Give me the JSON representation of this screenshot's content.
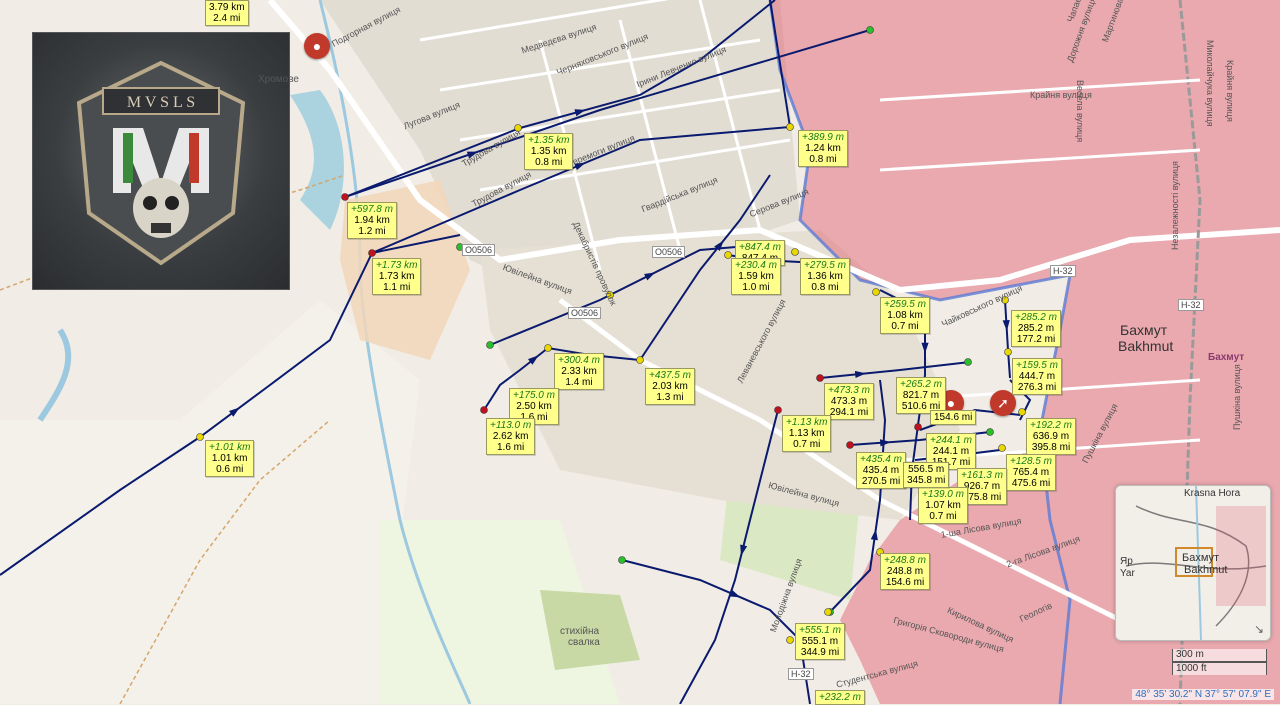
{
  "colors": {
    "occupied": "#e0576a",
    "route": "#0a1a6e",
    "label_bg": "#ffff8c",
    "start_point": "#2bbf2b",
    "end_point": "#c0121e",
    "waypoint": "#e8d800"
  },
  "logo": {
    "icon": "skull-shield-emblem",
    "text": "MVSLS"
  },
  "markers": [
    {
      "icon": "artillery-shell-icon"
    },
    {
      "icon": "artillery-shell-icon"
    },
    {
      "icon": "rifle-icon"
    }
  ],
  "distance_labels": [
    {
      "inc": "",
      "total": "3.79 km",
      "mi": "2.4 mi"
    },
    {
      "inc": "+597.8 m",
      "total": "1.94 km",
      "mi": "1.2 mi"
    },
    {
      "inc": "+1.35 km",
      "total": "1.35 km",
      "mi": "0.8 mi"
    },
    {
      "inc": "+389.9 m",
      "total": "1.24 km",
      "mi": "0.8 mi"
    },
    {
      "inc": "+1.73 km",
      "total": "1.73 km",
      "mi": "1.1 mi"
    },
    {
      "inc": "+847.4 m",
      "total": "847.4 m",
      "mi": ""
    },
    {
      "inc": "+230.4 m",
      "total": "1.59 km",
      "mi": "1.0 mi"
    },
    {
      "inc": "+279.5 m",
      "total": "1.36 km",
      "mi": "0.8 mi"
    },
    {
      "inc": "+259.5 m",
      "total": "1.08 km",
      "mi": "0.7 mi"
    },
    {
      "inc": "+285.2 m",
      "total": "285.2 m",
      "mi": "177.2 mi"
    },
    {
      "inc": "+300.4 m",
      "total": "2.33 km",
      "mi": "1.4 mi"
    },
    {
      "inc": "+437.5 m",
      "total": "2.03 km",
      "mi": "1.3 mi"
    },
    {
      "inc": "+159.5 m",
      "total": "444.7 m",
      "mi": "276.3 mi"
    },
    {
      "inc": "+175.0 m",
      "total": "2.50 km",
      "mi": "1.6 mi"
    },
    {
      "inc": "+473.3 m",
      "total": "473.3 m",
      "mi": "294.1 mi"
    },
    {
      "inc": "+265.2 m",
      "total": "821.7 m",
      "mi": "510.6 mi"
    },
    {
      "inc": "+113.0 m",
      "total": "2.62 km",
      "mi": "1.6 mi"
    },
    {
      "inc": "+1.13 km",
      "total": "1.13 km",
      "mi": "0.7 mi"
    },
    {
      "inc": "+192.2 m",
      "total": "636.9 m",
      "mi": "395.8 mi"
    },
    {
      "inc": "+244.1 m",
      "total": "244.1 m",
      "mi": "151.7 mi"
    },
    {
      "inc": "+1.01 km",
      "total": "1.01 km",
      "mi": "0.6 mi"
    },
    {
      "inc": "+435.4 m",
      "total": "435.4 m",
      "mi": "270.5 mi"
    },
    {
      "inc": "+128.5 m",
      "total": "765.4 m",
      "mi": "475.6 mi"
    },
    {
      "inc": "+161.3 m",
      "total": "926.7 m",
      "mi": "575.8 mi"
    },
    {
      "inc": "+139.0 m",
      "total": "1.07 km",
      "mi": "0.7 mi"
    },
    {
      "inc": "+248.8 m",
      "total": "248.8 m",
      "mi": "154.6 mi"
    },
    {
      "inc": "+555.1 m",
      "total": "555.1 m",
      "mi": "344.9 mi"
    },
    {
      "inc": "+232.2 m",
      "total": "",
      "mi": ""
    },
    {
      "inc": "",
      "total": "154.6 mi",
      "mi": ""
    },
    {
      "inc": "",
      "total": "556.5 m",
      "mi": "345.8 mi"
    }
  ],
  "streets": [
    "Подгорная вулиця",
    "Медведєва вулиця",
    "Черняховського вулиця",
    "Лугова вулиця",
    "Трудова вулиця",
    "Перемоги вулиця",
    "Ірини Левченко вулиця",
    "Ювілейна вулиця",
    "Левaнeвського вулиця",
    "Серова вулиця",
    "Гвардійська вулиця",
    "Декабристів провулок",
    "Чайковського вулиця",
    "Крайня вулиця",
    "Весела вулиця",
    "Дорожня вулиця",
    "Пушкіна вулиця",
    "1-ша Лісова вулиця",
    "2-га Лісова вулиця",
    "Кирилова вулиця",
    "Григорія Сковороди вулиця",
    "Геологів",
    "Молодіжна вулиця",
    "Студентська вулиця",
    "Ювілейна вулиця",
    "Миколайчука вулиця",
    "Крайня вулиця",
    "Трудова вулиця",
    "Пушкіна вулиця",
    "Чапаєва вулиця",
    "Мартинова вулиця",
    "Незалежності вулиця"
  ],
  "road_tags": [
    "O0506",
    "O0506",
    "O0506",
    "H-32",
    "H-32",
    "H-32"
  ],
  "place_labels": {
    "city_uk": "Бахмут",
    "city_en": "Bakhmut",
    "city_pin": "Бахмут",
    "landfill_1": "стихійна",
    "landfill_2": "свалка",
    "village": "Хромове"
  },
  "minimap": {
    "top": "Krasna Hora",
    "city_uk": "Бахмут",
    "city_en": "Bakhmut",
    "left_1": "Яр",
    "left_2": "Yar",
    "expand_icon": "expand-arrow-icon"
  },
  "scale": {
    "metric": "300 m",
    "imperial": "1000 ft"
  },
  "coords": "48° 35' 30.2\" N 37° 57' 07.9\" E"
}
